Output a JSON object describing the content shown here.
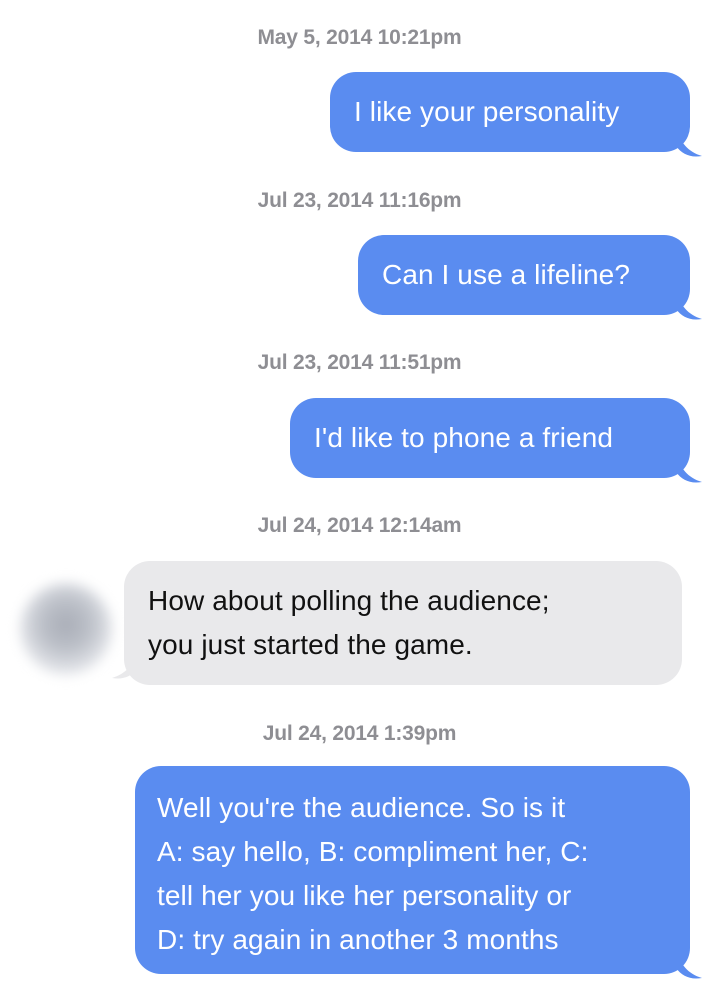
{
  "colors": {
    "outgoing_bubble": "#5a8cf0",
    "incoming_bubble": "#e9e9eb",
    "timestamp": "#8e8e93"
  },
  "messages": [
    {
      "timestamp": "May 5, 2014 10:21pm",
      "direction": "outgoing",
      "lines": [
        "I like your personality"
      ]
    },
    {
      "timestamp": "Jul 23, 2014 11:16pm",
      "direction": "outgoing",
      "lines": [
        "Can I use a lifeline?"
      ]
    },
    {
      "timestamp": "Jul 23, 2014 11:51pm",
      "direction": "outgoing",
      "lines": [
        "I'd like to phone a friend"
      ]
    },
    {
      "timestamp": "Jul 24, 2014 12:14am",
      "direction": "incoming",
      "lines": [
        "How about polling the audience;",
        "you just started the game."
      ]
    },
    {
      "timestamp": "Jul 24, 2014 1:39pm",
      "direction": "outgoing",
      "lines": [
        "Well you're the audience. So is it",
        "A: say hello, B: compliment her, C:",
        "tell her you like her personality or",
        "D: try again in another 3 months"
      ]
    }
  ]
}
